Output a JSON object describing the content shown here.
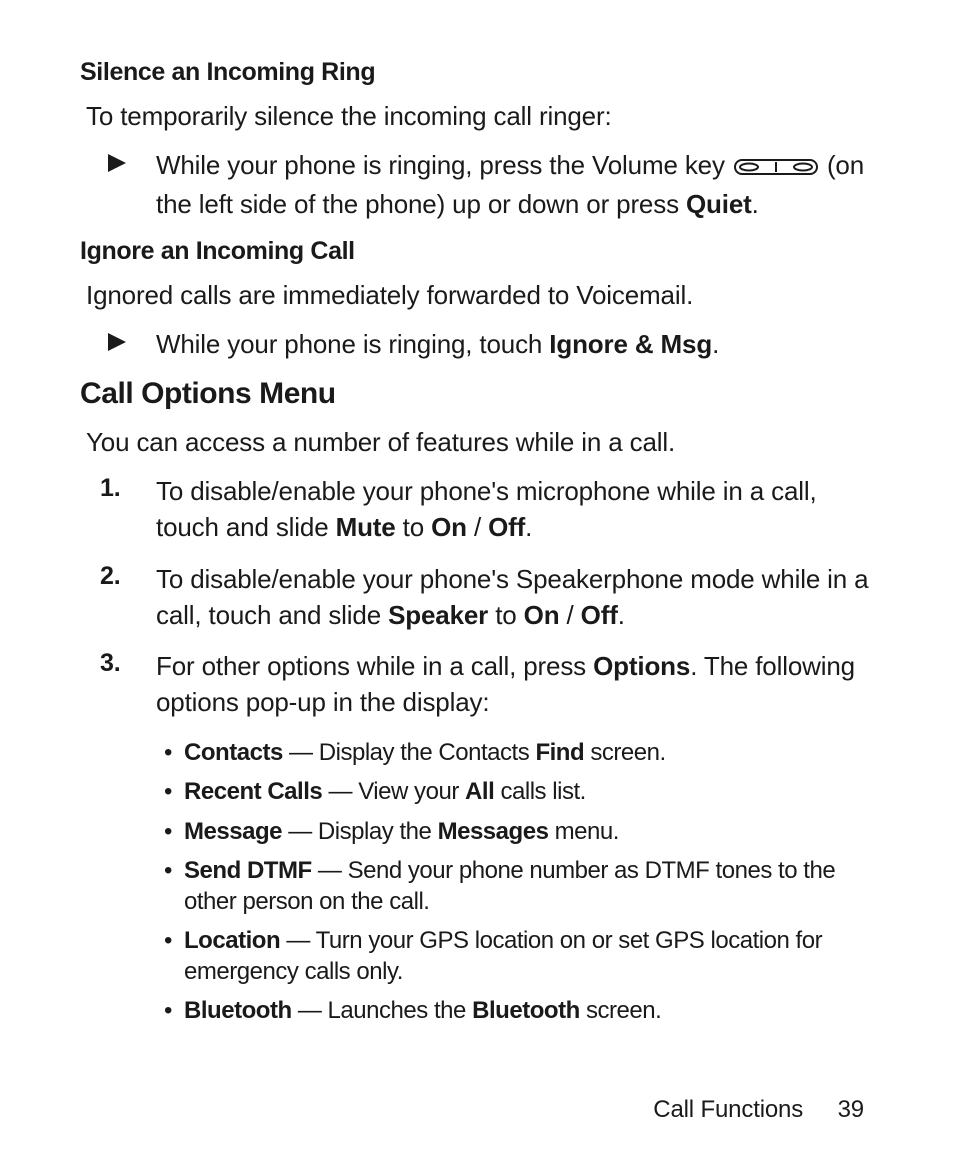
{
  "section1": {
    "heading": "Silence an Incoming Ring",
    "intro": "To temporarily silence the incoming call ringer:",
    "bullet_pre": "While your phone is ringing, press the Volume key ",
    "bullet_post1": "(on the left side of the phone) up or down or press ",
    "bullet_bold": "Quiet",
    "bullet_post2": "."
  },
  "section2": {
    "heading": "Ignore an Incoming Call",
    "intro": "Ignored calls are immediately forwarded to Voicemail.",
    "bullet_pre": "While your phone is ringing, touch ",
    "bullet_bold": "Ignore & Msg",
    "bullet_post": "."
  },
  "section3": {
    "heading": "Call Options Menu",
    "intro": "You can access a number of features while in a call.",
    "items": [
      {
        "n": "1.",
        "pre": "To disable/enable your phone's microphone while in a call, touch and slide ",
        "b1": "Mute",
        "mid1": " to ",
        "b2": "On",
        "mid2": " / ",
        "b3": "Off",
        "post": "."
      },
      {
        "n": "2.",
        "pre": "To disable/enable your phone's Speakerphone mode while in a call, touch and slide ",
        "b1": "Speaker",
        "mid1": " to ",
        "b2": "On",
        "mid2": " / ",
        "b3": "Off",
        "post": "."
      },
      {
        "n": "3.",
        "pre": "For other options while in a call, press ",
        "b1": "Options",
        "post": ". The following options pop-up in the display:"
      }
    ],
    "options": [
      {
        "b": "Contacts",
        "mid": " — Display the Contacts ",
        "b2": "Find",
        "post": " screen."
      },
      {
        "b": "Recent Calls",
        "mid": " — View your ",
        "b2": "All",
        "post": " calls list."
      },
      {
        "b": "Message",
        "mid": " — Display the ",
        "b2": "Messages",
        "post": " menu."
      },
      {
        "b": "Send DTMF",
        "mid": " — Send your phone number as DTMF tones to the other person on the call.",
        "b2": "",
        "post": ""
      },
      {
        "b": "Location",
        "mid": " — Turn your GPS location on or set GPS location for emergency calls only.",
        "b2": "",
        "post": ""
      },
      {
        "b": "Bluetooth",
        "mid": " — Launches the ",
        "b2": "Bluetooth",
        "post": " screen."
      }
    ]
  },
  "footer": {
    "chapter": "Call Functions",
    "page": "39"
  }
}
